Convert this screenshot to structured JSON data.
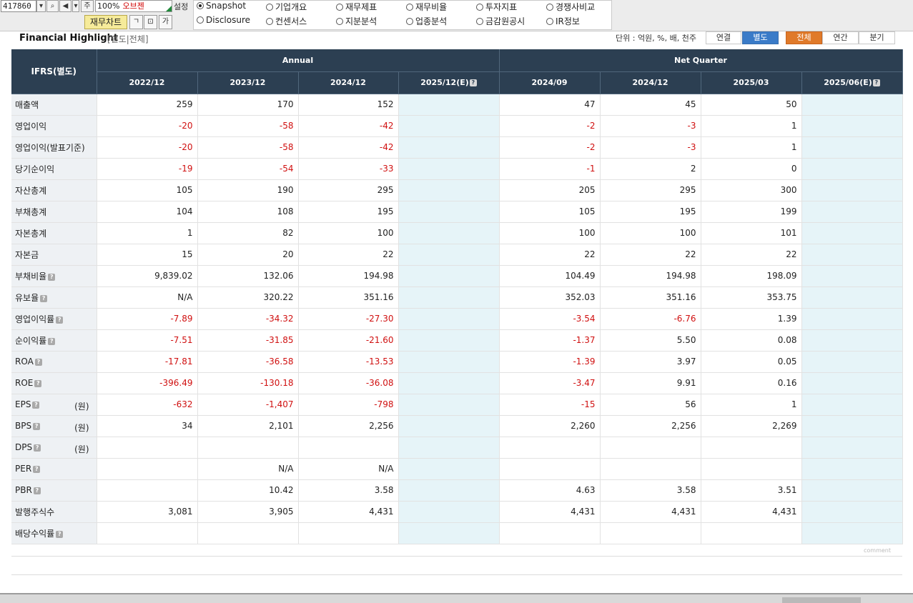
{
  "toolbar": {
    "code": "417860",
    "zoom": "100%",
    "company": "오브젠",
    "setting_label": "설정",
    "chart_button": "재무차트",
    "jong_button": "주"
  },
  "radios": [
    {
      "label": "Snapshot",
      "selected": true
    },
    {
      "label": "기업개요",
      "selected": false
    },
    {
      "label": "재무제표",
      "selected": false
    },
    {
      "label": "재무비율",
      "selected": false
    },
    {
      "label": "투자지표",
      "selected": false
    },
    {
      "label": "경쟁사비교",
      "selected": false
    },
    {
      "label": "Disclosure",
      "selected": false
    },
    {
      "label": "컨센서스",
      "selected": false
    },
    {
      "label": "지분분석",
      "selected": false
    },
    {
      "label": "업종분석",
      "selected": false
    },
    {
      "label": "금감원공시",
      "selected": false
    },
    {
      "label": "IR정보",
      "selected": false
    }
  ],
  "highlight": {
    "title": "Financial Highlight",
    "subtitle": "[별도|전체]",
    "unit_text": "단위 : 억원, %, 배, 천주",
    "seg_consolidated": "연결",
    "seg_separate": "별도",
    "seg_all": "전체",
    "seg_annual": "연간",
    "seg_quarter": "분기"
  },
  "table": {
    "corner": "IFRS(별도)",
    "group_annual": "Annual",
    "group_quarter": "Net Quarter",
    "columns": [
      "2022/12",
      "2023/12",
      "2024/12",
      "2025/12(E)",
      "2024/09",
      "2024/12",
      "2025/03",
      "2025/06(E)"
    ],
    "rows": [
      {
        "label": "매출액",
        "help": false,
        "unit": "",
        "values": [
          "259",
          "170",
          "152",
          "",
          "47",
          "45",
          "50",
          ""
        ]
      },
      {
        "label": "영업이익",
        "help": false,
        "unit": "",
        "values": [
          "-20",
          "-58",
          "-42",
          "",
          "-2",
          "-3",
          "1",
          ""
        ]
      },
      {
        "label": "영업이익(발표기준)",
        "help": false,
        "unit": "",
        "values": [
          "-20",
          "-58",
          "-42",
          "",
          "-2",
          "-3",
          "1",
          ""
        ]
      },
      {
        "label": "당기순이익",
        "help": false,
        "unit": "",
        "values": [
          "-19",
          "-54",
          "-33",
          "",
          "-1",
          "2",
          "0",
          ""
        ]
      },
      {
        "label": "자산총계",
        "help": false,
        "unit": "",
        "values": [
          "105",
          "190",
          "295",
          "",
          "205",
          "295",
          "300",
          ""
        ]
      },
      {
        "label": "부채총계",
        "help": false,
        "unit": "",
        "values": [
          "104",
          "108",
          "195",
          "",
          "105",
          "195",
          "199",
          ""
        ]
      },
      {
        "label": "자본총계",
        "help": false,
        "unit": "",
        "values": [
          "1",
          "82",
          "100",
          "",
          "100",
          "100",
          "101",
          ""
        ]
      },
      {
        "label": "자본금",
        "help": false,
        "unit": "",
        "values": [
          "15",
          "20",
          "22",
          "",
          "22",
          "22",
          "22",
          ""
        ]
      },
      {
        "label": "부채비율",
        "help": true,
        "unit": "",
        "values": [
          "9,839.02",
          "132.06",
          "194.98",
          "",
          "104.49",
          "194.98",
          "198.09",
          ""
        ]
      },
      {
        "label": "유보율",
        "help": true,
        "unit": "",
        "values": [
          "N/A",
          "320.22",
          "351.16",
          "",
          "352.03",
          "351.16",
          "353.75",
          ""
        ]
      },
      {
        "label": "영업이익률",
        "help": true,
        "unit": "",
        "values": [
          "-7.89",
          "-34.32",
          "-27.30",
          "",
          "-3.54",
          "-6.76",
          "1.39",
          ""
        ]
      },
      {
        "label": "순이익률",
        "help": true,
        "unit": "",
        "values": [
          "-7.51",
          "-31.85",
          "-21.60",
          "",
          "-1.37",
          "5.50",
          "0.08",
          ""
        ]
      },
      {
        "label": "ROA",
        "help": true,
        "unit": "",
        "values": [
          "-17.81",
          "-36.58",
          "-13.53",
          "",
          "-1.39",
          "3.97",
          "0.05",
          ""
        ]
      },
      {
        "label": "ROE",
        "help": true,
        "unit": "",
        "values": [
          "-396.49",
          "-130.18",
          "-36.08",
          "",
          "-3.47",
          "9.91",
          "0.16",
          ""
        ]
      },
      {
        "label": "EPS",
        "help": true,
        "unit": "(원)",
        "values": [
          "-632",
          "-1,407",
          "-798",
          "",
          "-15",
          "56",
          "1",
          ""
        ]
      },
      {
        "label": "BPS",
        "help": true,
        "unit": "(원)",
        "values": [
          "34",
          "2,101",
          "2,256",
          "",
          "2,260",
          "2,256",
          "2,269",
          ""
        ]
      },
      {
        "label": "DPS",
        "help": true,
        "unit": "(원)",
        "values": [
          "",
          "",
          "",
          "",
          "",
          "",
          "",
          ""
        ]
      },
      {
        "label": "PER",
        "help": true,
        "unit": "",
        "values": [
          "",
          "N/A",
          "N/A",
          "",
          "",
          "",
          "",
          ""
        ]
      },
      {
        "label": "PBR",
        "help": true,
        "unit": "",
        "values": [
          "",
          "10.42",
          "3.58",
          "",
          "4.63",
          "3.58",
          "3.51",
          ""
        ]
      },
      {
        "label": "발행주식수",
        "help": false,
        "unit": "",
        "values": [
          "3,081",
          "3,905",
          "4,431",
          "",
          "4,431",
          "4,431",
          "4,431",
          ""
        ]
      },
      {
        "label": "배당수익률",
        "help": true,
        "unit": "",
        "values": [
          "",
          "",
          "",
          "",
          "",
          "",
          "",
          ""
        ]
      }
    ]
  },
  "footer": {
    "comment": "comment"
  },
  "colors": {
    "header_bg": "#2c3f52",
    "negative": "#d01010",
    "estimate_bg": "#e6f4f8",
    "label_bg": "#eef1f4"
  }
}
